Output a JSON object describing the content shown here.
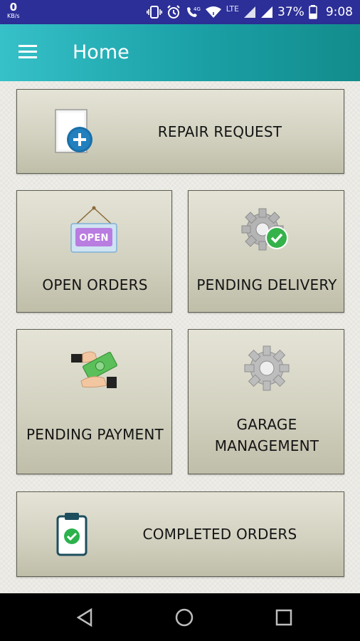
{
  "status_bar": {
    "net_speed": "0",
    "net_unit": "KB/s",
    "network": "LTE",
    "battery": "37%",
    "time": "9:08"
  },
  "app_bar": {
    "title": "Home"
  },
  "tiles": {
    "repair_request": "REPAIR REQUEST",
    "open_orders": "OPEN ORDERS",
    "open_sign_text": "OPEN",
    "pending_delivery": "PENDING DELIVERY",
    "pending_payment": "PENDING PAYMENT",
    "garage_management_line1": "GARAGE",
    "garage_management_line2": "MANAGEMENT",
    "completed_orders": "COMPLETED ORDERS"
  },
  "icons": {
    "menu": "hamburger-menu-icon",
    "repair_request": "document-add-icon",
    "open_orders": "open-sign-icon",
    "pending_delivery": "gear-check-icon",
    "pending_payment": "money-handover-icon",
    "garage_management": "gear-icon",
    "completed_orders": "clipboard-check-icon"
  },
  "colors": {
    "status_bar": "#2c2f97",
    "app_bar": "#1aa0a6",
    "tile": "#d3d2c1",
    "check": "#35b24a",
    "plus": "#1a6fa8"
  }
}
